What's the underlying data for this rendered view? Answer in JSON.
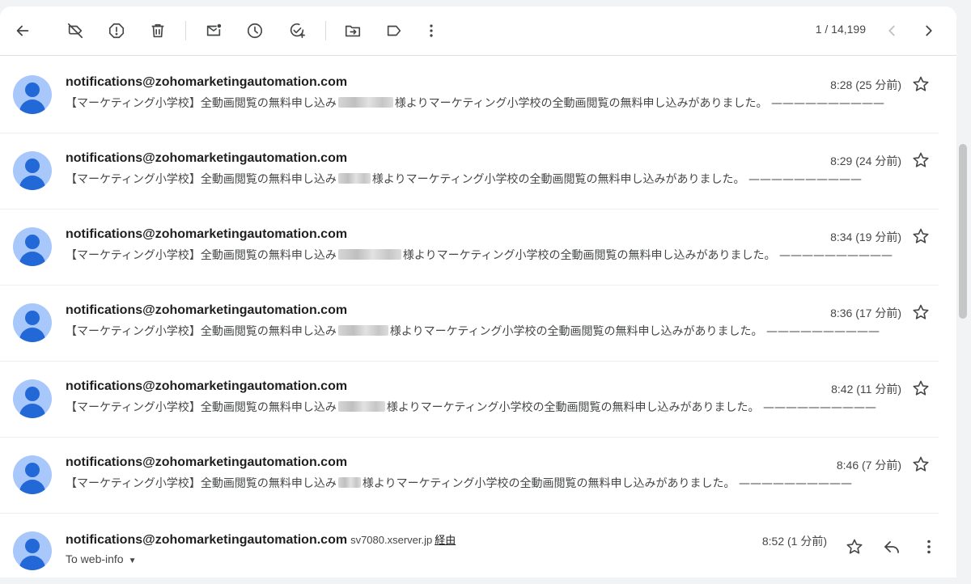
{
  "toolbar": {
    "counter": "1 / 14,199",
    "icons": [
      "back-arrow-icon",
      "unsnooze-icon",
      "report-spam-icon",
      "delete-icon",
      "mark-unread-icon",
      "snooze-icon",
      "add-task-icon",
      "move-to-icon",
      "label-icon",
      "more-vert-icon",
      "chevron-left-icon",
      "chevron-right-icon"
    ]
  },
  "messages": [
    {
      "sender": "notifications@zohomarketingautomation.com",
      "snippet_before": "【マーケティング小学校】全動画閲覧の無料申し込み",
      "snippet_after": "様よりマーケティング小学校の全動画閲覧の無料申し込みがありました。 ——————————",
      "time": "8:28 (25 分前)"
    },
    {
      "sender": "notifications@zohomarketingautomation.com",
      "snippet_before": "【マーケティング小学校】全動画閲覧の無料申し込み",
      "snippet_after": "様よりマーケティング小学校の全動画閲覧の無料申し込みがありました。 ——————————",
      "time": "8:29 (24 分前)"
    },
    {
      "sender": "notifications@zohomarketingautomation.com",
      "snippet_before": "【マーケティング小学校】全動画閲覧の無料申し込み",
      "snippet_after": "様よりマーケティング小学校の全動画閲覧の無料申し込みがありました。 ——————————",
      "time": "8:34 (19 分前)"
    },
    {
      "sender": "notifications@zohomarketingautomation.com",
      "snippet_before": "【マーケティング小学校】全動画閲覧の無料申し込み",
      "snippet_after": "様よりマーケティング小学校の全動画閲覧の無料申し込みがありました。 ——————————",
      "time": "8:36 (17 分前)"
    },
    {
      "sender": "notifications@zohomarketingautomation.com",
      "snippet_before": "【マーケティング小学校】全動画閲覧の無料申し込み",
      "snippet_after": "様よりマーケティング小学校の全動画閲覧の無料申し込みがありました。 ——————————",
      "time": "8:42 (11 分前)"
    },
    {
      "sender": "notifications@zohomarketingautomation.com",
      "snippet_before": "【マーケティング小学校】全動画閲覧の無料申し込み",
      "snippet_after": "様よりマーケティング小学校の全動画閲覧の無料申し込みがありました。 ——————————",
      "time": "8:46 (7 分前)"
    }
  ],
  "open_message": {
    "sender": "notifications@zohomarketingautomation.com",
    "via_server": "sv7080.xserver.jp",
    "via_label": "経由",
    "to": "To web-info",
    "time": "8:52 (1 分前)"
  },
  "colors": {
    "avatar_bg": "#a8c7fa",
    "avatar_fg": "#0b57d0",
    "text_primary": "#1f1f1f",
    "text_secondary": "#444746"
  }
}
